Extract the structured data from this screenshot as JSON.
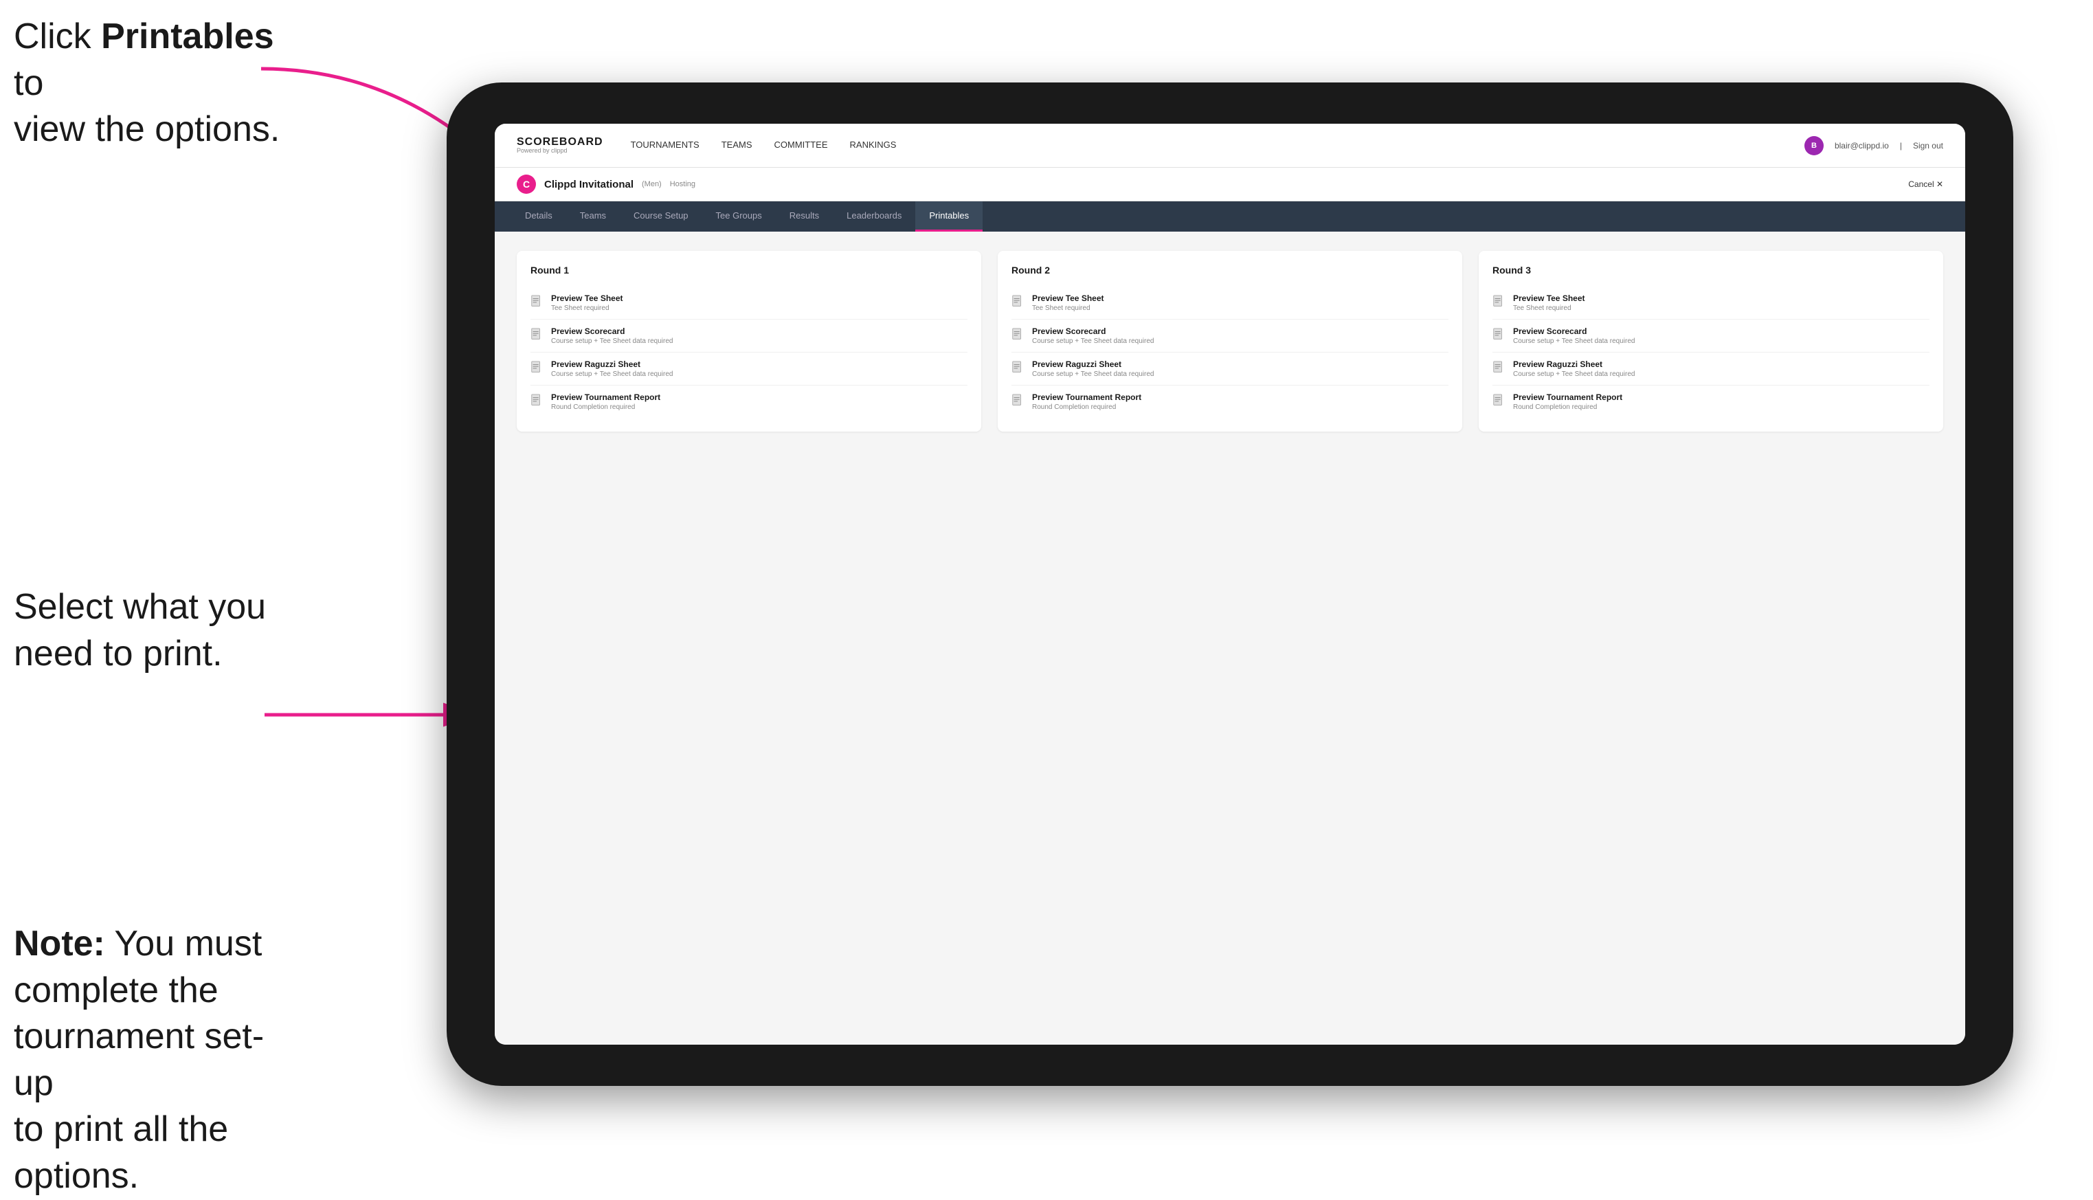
{
  "annotations": {
    "top_text_part1": "Click ",
    "top_text_bold": "Printables",
    "top_text_part2": " to\nview the options.",
    "middle_text": "Select what you\nneed to print.",
    "bottom_note_bold": "Note:",
    "bottom_note_text": " You must\ncomplete the\ntournament set-up\nto print all the\noptions."
  },
  "top_nav": {
    "logo_title": "SCOREBOARD",
    "logo_subtitle": "Powered by clippd",
    "nav_links": [
      {
        "label": "TOURNAMENTS",
        "active": false
      },
      {
        "label": "TEAMS",
        "active": false
      },
      {
        "label": "COMMITTEE",
        "active": false
      },
      {
        "label": "RANKINGS",
        "active": false
      }
    ],
    "user_email": "blair@clippd.io",
    "sign_out": "Sign out",
    "user_initial": "B"
  },
  "tournament_header": {
    "logo_letter": "C",
    "title": "Clippd Invitational",
    "category": "(Men)",
    "status": "Hosting",
    "cancel_label": "Cancel ✕"
  },
  "tabs": [
    {
      "label": "Details",
      "active": false
    },
    {
      "label": "Teams",
      "active": false
    },
    {
      "label": "Course Setup",
      "active": false
    },
    {
      "label": "Tee Groups",
      "active": false
    },
    {
      "label": "Results",
      "active": false
    },
    {
      "label": "Leaderboards",
      "active": false
    },
    {
      "label": "Printables",
      "active": true
    }
  ],
  "rounds": [
    {
      "title": "Round 1",
      "items": [
        {
          "title": "Preview Tee Sheet",
          "subtitle": "Tee Sheet required"
        },
        {
          "title": "Preview Scorecard",
          "subtitle": "Course setup + Tee Sheet data required"
        },
        {
          "title": "Preview Raguzzi Sheet",
          "subtitle": "Course setup + Tee Sheet data required"
        },
        {
          "title": "Preview Tournament Report",
          "subtitle": "Round Completion required"
        }
      ]
    },
    {
      "title": "Round 2",
      "items": [
        {
          "title": "Preview Tee Sheet",
          "subtitle": "Tee Sheet required"
        },
        {
          "title": "Preview Scorecard",
          "subtitle": "Course setup + Tee Sheet data required"
        },
        {
          "title": "Preview Raguzzi Sheet",
          "subtitle": "Course setup + Tee Sheet data required"
        },
        {
          "title": "Preview Tournament Report",
          "subtitle": "Round Completion required"
        }
      ]
    },
    {
      "title": "Round 3",
      "items": [
        {
          "title": "Preview Tee Sheet",
          "subtitle": "Tee Sheet required"
        },
        {
          "title": "Preview Scorecard",
          "subtitle": "Course setup + Tee Sheet data required"
        },
        {
          "title": "Preview Raguzzi Sheet",
          "subtitle": "Course setup + Tee Sheet data required"
        },
        {
          "title": "Preview Tournament Report",
          "subtitle": "Round Completion required"
        }
      ]
    }
  ],
  "colors": {
    "accent": "#e91e8c",
    "arrow": "#e91e8c",
    "nav_bg": "#2d3a4a"
  }
}
